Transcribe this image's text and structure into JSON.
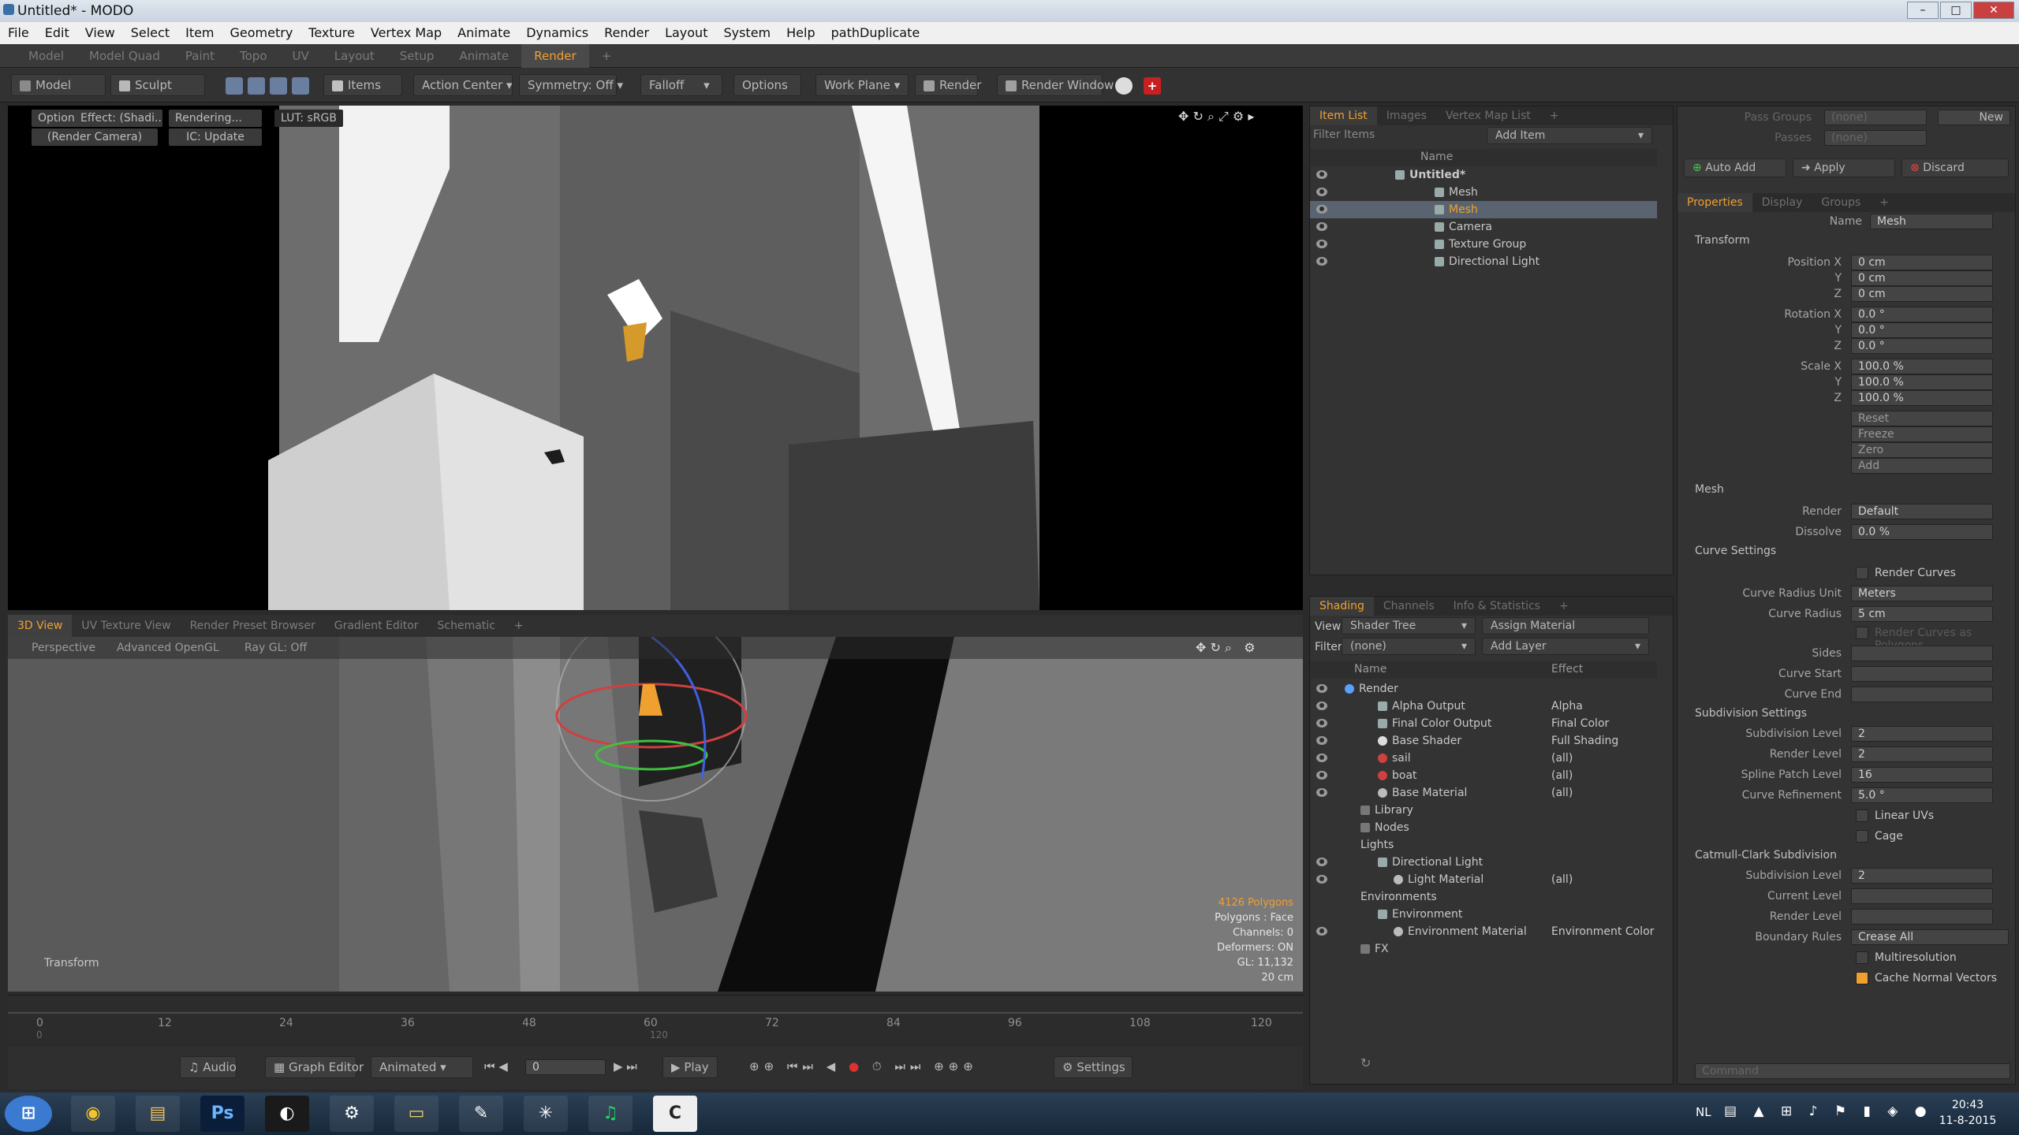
{
  "app": {
    "title": "Untitled* - MODO",
    "window_buttons": [
      "–",
      "□",
      "✕"
    ]
  },
  "menubar": [
    "File",
    "Edit",
    "View",
    "Select",
    "Item",
    "Geometry",
    "Texture",
    "Vertex Map",
    "Animate",
    "Dynamics",
    "Render",
    "Layout",
    "System",
    "Help",
    "pathDuplicate"
  ],
  "layout_tabs": [
    "Model",
    "Model Quad",
    "Paint",
    "Topo",
    "UV",
    "Layout",
    "Setup",
    "Animate",
    "Render",
    "+"
  ],
  "layout_tab_active": "Render",
  "toolbar": {
    "model": "Model",
    "sculpt": "Sculpt",
    "items": "Items",
    "action_center": "Action Center",
    "symmetry": "Symmetry: Off",
    "falloff": "Falloff",
    "options": "Options",
    "work_plane": "Work Plane",
    "render": "Render",
    "render_window": "Render Window"
  },
  "viewport_top": {
    "options": "Options",
    "effect": "Effect: (Shadi...",
    "rendering": "Rendering...",
    "lut": "LUT: sRGB",
    "camera": "(Render Camera)",
    "ic": "IC: Update"
  },
  "viewport_bottom": {
    "tabs": [
      "3D View",
      "UV Texture View",
      "Render Preset Browser",
      "Gradient Editor",
      "Schematic",
      "+"
    ],
    "active_tab": "3D View",
    "perspective": "Perspective",
    "shading": "Advanced OpenGL",
    "raygl": "Ray GL: Off",
    "tool_label": "Transform",
    "stats": [
      "4126 Polygons",
      "Polygons : Face",
      "Channels: 0",
      "Deformers: ON",
      "GL: 11,132",
      "20 cm"
    ]
  },
  "timeline": {
    "ticks": [
      "0",
      "12",
      "24",
      "36",
      "48",
      "60",
      "72",
      "84",
      "96",
      "108",
      "120"
    ],
    "sub_ticks": [
      "0",
      "120"
    ]
  },
  "transport": {
    "audio": "Audio",
    "graph_editor": "Graph Editor",
    "animated": "Animated",
    "frame": "0",
    "play": "Play",
    "settings": "Settings"
  },
  "item_list": {
    "tabs": [
      "Item List",
      "Images",
      "Vertex Map List",
      "+"
    ],
    "filter": "Filter Items",
    "add_item": "Add Item",
    "name_col": "Name",
    "items": [
      {
        "label": "Untitled*",
        "depth": 0
      },
      {
        "label": "Mesh",
        "depth": 1
      },
      {
        "label": "Mesh",
        "depth": 1,
        "selected": true
      },
      {
        "label": "Camera",
        "depth": 1
      },
      {
        "label": "Texture Group",
        "depth": 1
      },
      {
        "label": "Directional Light",
        "depth": 1
      }
    ]
  },
  "shading": {
    "tabs": [
      "Shading",
      "Channels",
      "Info & Statistics",
      "+"
    ],
    "view_label": "View",
    "view_value": "Shader Tree",
    "assign": "Assign Material",
    "filter_label": "Filter",
    "filter_value": "(none)",
    "add_layer": "Add Layer",
    "name_col": "Name",
    "effect_col": "Effect",
    "rows": [
      {
        "label": "Render",
        "effect": "",
        "depth": 0
      },
      {
        "label": "Alpha Output",
        "effect": "Alpha",
        "depth": 1
      },
      {
        "label": "Final Color Output",
        "effect": "Final Color",
        "depth": 1
      },
      {
        "label": "Base Shader",
        "effect": "Full Shading",
        "depth": 1
      },
      {
        "label": "sail",
        "effect": "(all)",
        "depth": 1
      },
      {
        "label": "boat",
        "effect": "(all)",
        "depth": 1
      },
      {
        "label": "Base Material",
        "effect": "(all)",
        "depth": 1
      },
      {
        "label": "Library",
        "effect": "",
        "depth": 0
      },
      {
        "label": "Nodes",
        "effect": "",
        "depth": 0
      },
      {
        "label": "Lights",
        "effect": "",
        "depth": 0
      },
      {
        "label": "Directional Light",
        "effect": "",
        "depth": 1
      },
      {
        "label": "Light Material",
        "effect": "(all)",
        "depth": 2
      },
      {
        "label": "Environments",
        "effect": "",
        "depth": 0
      },
      {
        "label": "Environment",
        "effect": "",
        "depth": 1
      },
      {
        "label": "Environment Material",
        "effect": "Environment Color",
        "depth": 2
      },
      {
        "label": "FX",
        "effect": "",
        "depth": 0
      }
    ]
  },
  "properties": {
    "pass_groups": "Pass Groups",
    "passes": "Passes",
    "pass_groups_value": "(none)",
    "passes_value": "(none)",
    "new": "New",
    "auto_add": "Auto Add",
    "apply": "Apply",
    "discard": "Discard",
    "tabs": [
      "Properties",
      "Display",
      "Groups",
      "+"
    ],
    "name_label": "Name",
    "name_value": "Mesh",
    "transform": "Transform",
    "position_label": "Position X",
    "position": [
      "0 cm",
      "0 cm",
      "0 cm"
    ],
    "rotation_label": "Rotation X",
    "rotation": [
      "0.0 °",
      "0.0 °",
      "0.0 °"
    ],
    "scale_label": "Scale X",
    "scale": [
      "100.0 %",
      "100.0 %",
      "100.0 %"
    ],
    "axis_y": "Y",
    "axis_z": "Z",
    "transform_buttons": [
      "Reset",
      "Freeze",
      "Zero",
      "Add"
    ],
    "mesh": "Mesh",
    "render_label": "Render",
    "render_value": "Default",
    "dissolve_label": "Dissolve",
    "dissolve_value": "0.0 %",
    "curve_settings": "Curve Settings",
    "render_curves": "Render Curves",
    "curve_radius_unit": "Curve Radius Unit",
    "curve_radius_unit_value": "Meters",
    "curve_radius": "Curve Radius",
    "curve_radius_value": "5 cm",
    "render_curves_polygons": "Render Curves as Polygons",
    "sides": "Sides",
    "curve_start": "Curve Start",
    "curve_end": "Curve End",
    "subdivision_settings": "Subdivision Settings",
    "subdivision_level_label": "Subdivision Level",
    "subdivision_level": "2",
    "render_level_label": "Render Level",
    "render_level": "2",
    "spline_patch_label": "Spline Patch Level",
    "spline_patch": "16",
    "curve_refinement_label": "Curve Refinement",
    "curve_refinement": "5.0 °",
    "linear_uvs": "Linear UVs",
    "cage": "Cage",
    "catmull": "Catmull-Clark Subdivision",
    "cc_subdivision_level": "2",
    "current_level": "Current Level",
    "cc_render_level": "Render Level",
    "boundary_rules_label": "Boundary Rules",
    "boundary_rules": "Crease All",
    "multiresolution": "Multiresolution",
    "cache_normals": "Cache Normal Vectors",
    "command": "Command"
  },
  "taskbar": {
    "apps": [
      "⊞",
      "◉",
      "▤",
      "Ps",
      "◐",
      "⚙",
      "▭",
      "✎",
      "✳",
      "♫",
      "C"
    ],
    "lang": "NL",
    "time": "20:43",
    "date": "11-8-2015"
  },
  "colors": {
    "accent": "#f0a030",
    "panel": "#333333",
    "selected": "#556070"
  }
}
